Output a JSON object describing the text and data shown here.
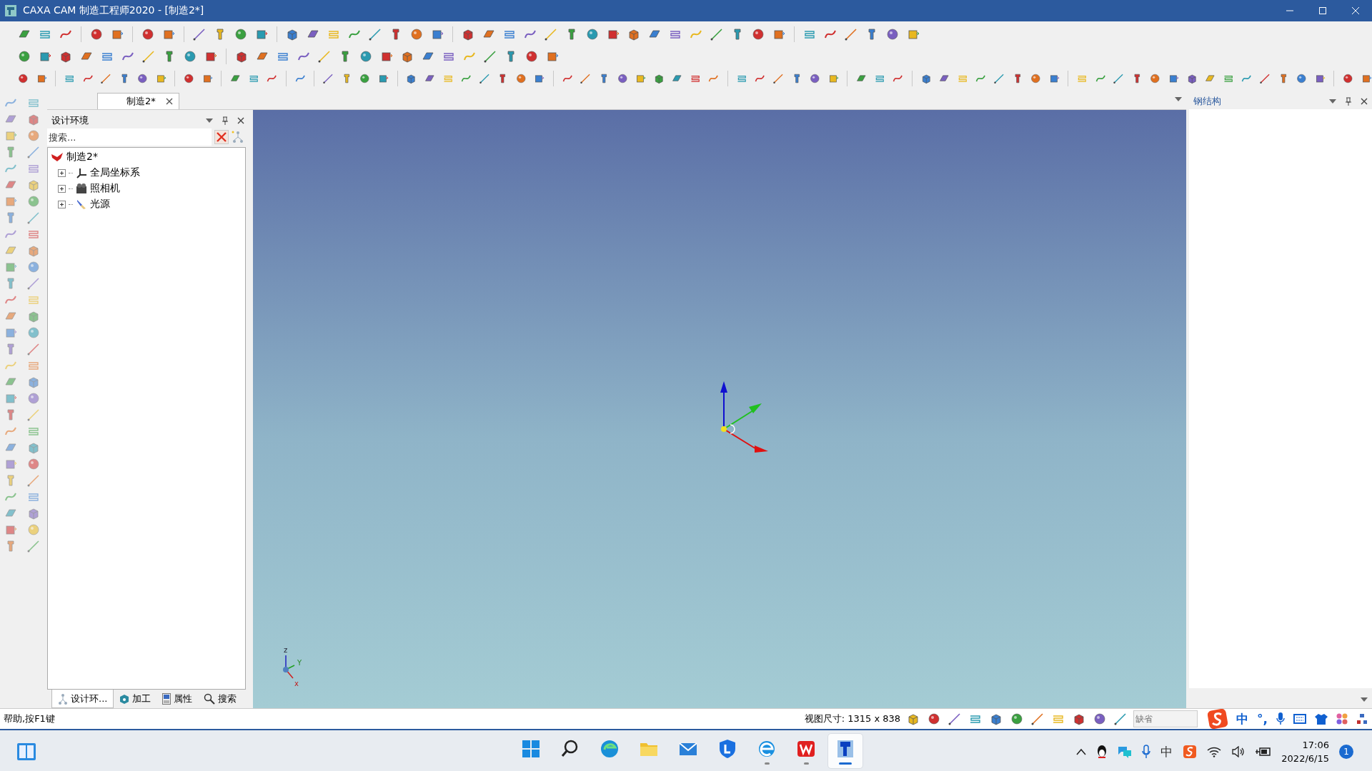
{
  "window": {
    "title": "CAXA CAM 制造工程师2020 - [制造2*]"
  },
  "document_tabs": [
    {
      "label": "制造2*",
      "selected": true
    }
  ],
  "design_panel": {
    "title": "设计环境",
    "search": {
      "placeholder": "搜索..."
    },
    "tree": [
      {
        "label": "制造2*",
        "children": [
          {
            "label": "全局坐标系",
            "expanded": false,
            "kind": "axes"
          },
          {
            "label": "照相机",
            "expanded": false,
            "kind": "camera"
          },
          {
            "label": "光源",
            "expanded": false,
            "kind": "light"
          }
        ]
      }
    ],
    "bottom_tabs": [
      {
        "label": "设计环...",
        "selected": true,
        "kind": "tree"
      },
      {
        "label": "加工",
        "selected": false,
        "kind": "machining"
      },
      {
        "label": "属性",
        "selected": false,
        "kind": "properties"
      },
      {
        "label": "搜索",
        "selected": false,
        "kind": "search"
      }
    ]
  },
  "viewport": {
    "axis_labels": [
      "z",
      "Y",
      "x"
    ]
  },
  "right_panel": {
    "title": "钢结构"
  },
  "status_bar": {
    "help": "帮助,按F1键",
    "view_size": "视图尺寸: 1315 x  838",
    "field": {
      "placeholder": "缺省"
    }
  },
  "ime_bar": {
    "mode": "中",
    "punctuation": "°,"
  },
  "taskbar": {
    "apps": [
      {
        "kind": "start",
        "running": false,
        "selected": false
      },
      {
        "kind": "search",
        "running": false,
        "selected": false
      },
      {
        "kind": "edge",
        "running": false,
        "selected": false
      },
      {
        "kind": "files",
        "running": false,
        "selected": false
      },
      {
        "kind": "mail",
        "running": false,
        "selected": false
      },
      {
        "kind": "shield",
        "running": false,
        "selected": false
      },
      {
        "kind": "browser",
        "running": true,
        "selected": false
      },
      {
        "kind": "wps",
        "running": true,
        "selected": false
      },
      {
        "kind": "caxa",
        "running": true,
        "selected": true
      }
    ],
    "tray_ime": "中",
    "time": "17:06",
    "date": "2022/6/15",
    "notifications": "1"
  }
}
